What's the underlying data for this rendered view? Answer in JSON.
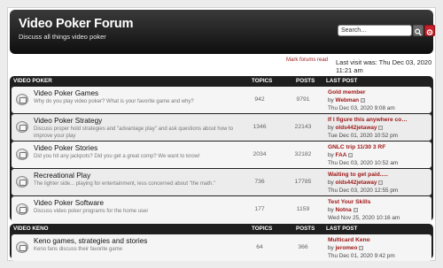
{
  "header": {
    "title": "Video Poker Forum",
    "description": "Discuss all things video poker",
    "search_value": "Search…"
  },
  "subheader": {
    "mark_read": "Mark forums read",
    "last_visit": "Last visit was: Thu Dec 03, 2020 11:21 am"
  },
  "sections": [
    {
      "title": "VIDEO POKER",
      "col_topics": "TOPICS",
      "col_posts": "POSTS",
      "col_last": "LAST POST",
      "forums": [
        {
          "name": "Video Poker Games",
          "desc": "Why do you play video poker? What is your favorite game and why?",
          "topics": "942",
          "posts": "9791",
          "last_title": "Gold member",
          "by": "by",
          "last_user": "Webman",
          "last_date": "Thu Dec 03, 2020 9:08 am"
        },
        {
          "name": "Video Poker Strategy",
          "desc": "Discuss proper hold strategies and \"advantage play\" and ask questions about how to improve your play",
          "topics": "1346",
          "posts": "22143",
          "last_title": "If I figure this anywhere co…",
          "by": "by",
          "last_user": "olds442jetaway",
          "last_date": "Tue Dec 01, 2020 10:52 pm"
        },
        {
          "name": "Video Poker Stories",
          "desc": "Did you hit any jackpots? Did you get a great comp? We want to know!",
          "topics": "2034",
          "posts": "32182",
          "last_title": "GNLC trip 11/30 3 RF",
          "by": "by",
          "last_user": "FAA",
          "last_date": "Thu Dec 03, 2020 10:52 am"
        },
        {
          "name": "Recreational Play",
          "desc": "The lighter side... playing for entertainment, less concerned about \"the math.\"",
          "topics": "736",
          "posts": "17785",
          "last_title": "Waiting to get paid.....",
          "by": "by",
          "last_user": "olds442jetaway",
          "last_date": "Thu Dec 03, 2020 12:55 pm"
        },
        {
          "name": "Video Poker Software",
          "desc": "Discuss video poker programs for the home user",
          "topics": "177",
          "posts": "1159",
          "last_title": "Test Your Skills",
          "by": "by",
          "last_user": "Notna",
          "last_date": "Wed Nov 25, 2020 10:16 am"
        }
      ]
    },
    {
      "title": "VIDEO KENO",
      "col_topics": "TOPICS",
      "col_posts": "POSTS",
      "col_last": "LAST POST",
      "forums": [
        {
          "name": "Keno games, strategies and stories",
          "desc": "Keno fans discuss their favorite game",
          "topics": "64",
          "posts": "366",
          "last_title": "Multicard Keno",
          "by": "by",
          "last_user": "jeromeo",
          "last_date": "Thu Dec 01, 2020 9:42 pm"
        }
      ]
    }
  ]
}
